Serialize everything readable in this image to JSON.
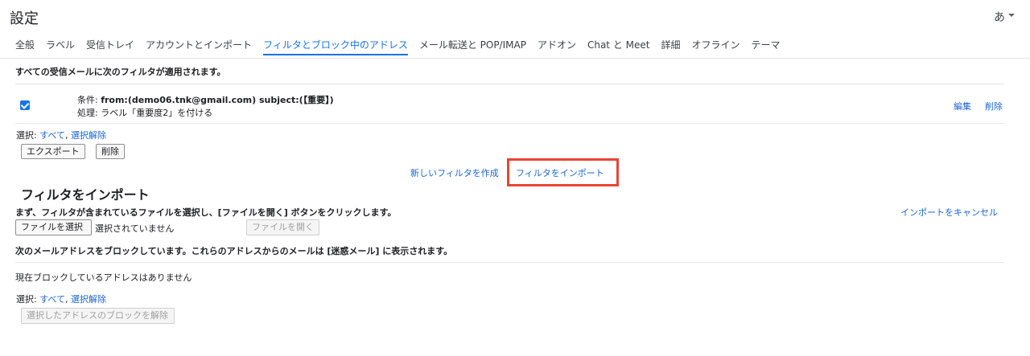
{
  "header": {
    "title": "設定",
    "ime_label": "あ"
  },
  "tabs": [
    {
      "label": "全般"
    },
    {
      "label": "ラベル"
    },
    {
      "label": "受信トレイ"
    },
    {
      "label": "アカウントとインポート"
    },
    {
      "label": "フィルタとブロック中のアドレス",
      "active": true
    },
    {
      "label": "メール転送と POP/IMAP"
    },
    {
      "label": "アドオン"
    },
    {
      "label": "Chat と Meet"
    },
    {
      "label": "詳細"
    },
    {
      "label": "オフライン"
    },
    {
      "label": "テーマ"
    }
  ],
  "filters": {
    "heading": "すべての受信メールに次のフィルタが適用されます。",
    "item": {
      "criteria_prefix": "条件: ",
      "criteria": "from:(demo06.tnk@gmail.com) subject:(【重要】)",
      "action": "処理: ラベル「重要度2」を付ける",
      "checked": true,
      "edit": "編集",
      "delete": "削除"
    },
    "select_label": "選択: ",
    "select_all": "すべて",
    "comma": ", ",
    "select_none": "選択解除",
    "export_button": "エクスポート",
    "delete_button": "削除",
    "create_filter": "新しいフィルタを作成",
    "import_filter": "フィルタをインポート"
  },
  "import": {
    "heading": "フィルタをインポート",
    "instruction": "まず、フィルタが含まれているファイルを選択し、[ファイルを開く] ボタンをクリックします。",
    "cancel": "インポートをキャンセル",
    "choose_file": "ファイルを選択",
    "no_file": "選択されていません",
    "open_file": "ファイルを開く"
  },
  "blocked": {
    "heading": "次のメールアドレスをブロックしています。これらのアドレスからのメールは [迷惑メール] に表示されます。",
    "empty": "現在ブロックしているアドレスはありません",
    "select_label": "選択: ",
    "select_all": "すべて",
    "comma": ", ",
    "select_none": "選択解除",
    "unblock_button": "選択したアドレスのブロックを解除"
  },
  "colors": {
    "accent": "#1a73e8",
    "link": "#1a66d2",
    "highlight": "#ea4335"
  }
}
